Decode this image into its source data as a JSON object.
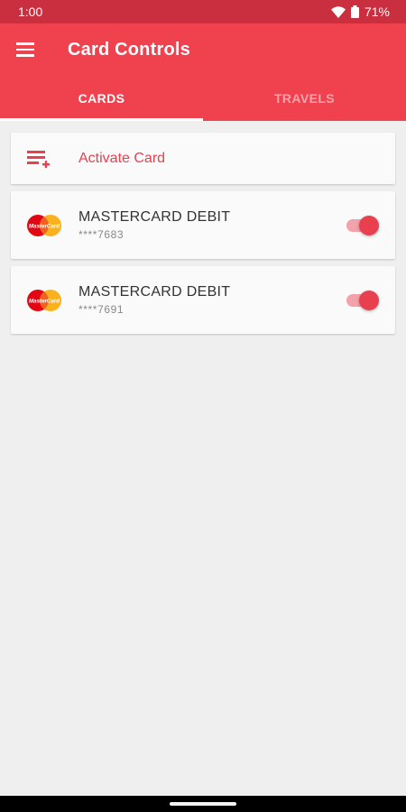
{
  "status_bar": {
    "time": "1:00",
    "battery": "71%",
    "icons": [
      "wifi-icon",
      "battery-icon"
    ]
  },
  "app_bar": {
    "title": "Card Controls",
    "menu_icon": "hamburger-menu-icon"
  },
  "tabs": [
    {
      "label": "CARDS",
      "active": true
    },
    {
      "label": "TRAVELS",
      "active": false
    }
  ],
  "activate_card": {
    "label": "Activate Card",
    "icon": "add-card-icon"
  },
  "cards": [
    {
      "name": "MASTERCARD DEBIT",
      "number": "****7683",
      "enabled": true,
      "logo": "mastercard-logo"
    },
    {
      "name": "MASTERCARD DEBIT",
      "number": "****7691",
      "enabled": true,
      "logo": "mastercard-logo"
    }
  ],
  "colors": {
    "primary": "#f0414f",
    "status_bar": "#c92f3e",
    "accent": "#e8404f",
    "background": "#efefef"
  }
}
